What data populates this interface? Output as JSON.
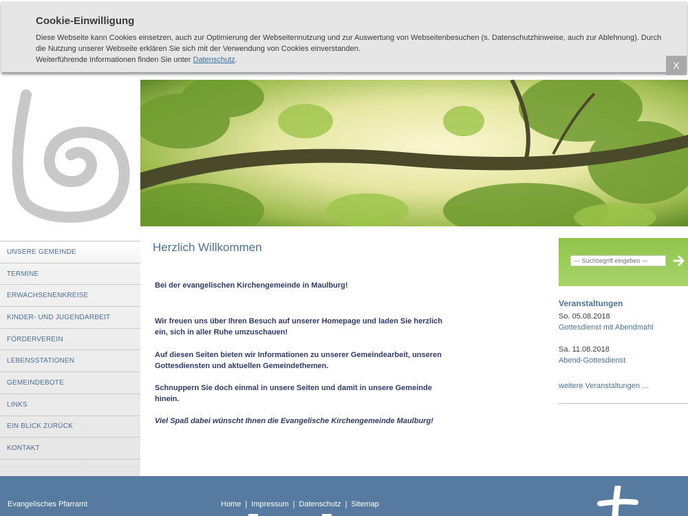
{
  "cookie": {
    "title": "Cookie-Einwilligung",
    "text1": "Diese Webseite kann Cookies einsetzen, auch zur Optimierung der Webseitennutzung und zur Auswertung von Webseitenbesuchen (s. Datenschutzhinweise, auch zur Ablehnung). Durch die Nutzung unserer Webseite erklären Sie sich mit der Verwendung von Cookies einverstanden.",
    "text2": "Weiterführende Informationen finden Sie unter ",
    "link": "Datenschutz",
    "after_link": ".",
    "close": "X"
  },
  "nav": {
    "items": [
      {
        "label": "UNSERE GEMEINDE"
      },
      {
        "label": "TERMINE"
      },
      {
        "label": "ERWACHSENENKREISE"
      },
      {
        "label": "KINDER- UND JUGENDARBEIT"
      },
      {
        "label": "FÖRDERVEREIN"
      },
      {
        "label": "LEBENSSTATIONEN"
      },
      {
        "label": "GEMEINDEBOTE"
      },
      {
        "label": "LINKS"
      },
      {
        "label": "EIN BLICK ZURÜCK"
      },
      {
        "label": "KONTAKT"
      }
    ]
  },
  "main": {
    "title": "Herzlich Willkommen",
    "paragraphs": [
      "Bei der evangelischen Kirchengemeinde in Maulburg!",
      "Wir freuen uns über Ihren Besuch auf unserer Homepage und laden Sie herzlich ein, sich in aller Ruhe umzuschauen!",
      "Auf diesen Seiten bieten wir Informationen zu unserer Gemeindearbeit, unseren Gottesdiensten und aktuellen Gemeindethemen.",
      "Schnuppern Sie doch einmal in unsere Seiten und damit in unsere Gemeinde hinein.",
      "Viel Spaß dabei wünscht Ihnen die Evangelische Kirchengemeinde Maulburg!"
    ]
  },
  "search": {
    "placeholder": "--- Suchbegriff eingeben ---"
  },
  "events": {
    "title": "Veranstaltungen",
    "items": [
      {
        "date": "So. 05.08.2018",
        "title": "Gottesdienst mit Abendmahl"
      },
      {
        "date": "Sa. 11.08.2018",
        "title": "Abend-Gottesdienst"
      }
    ],
    "more": "weitere Veranstaltungen ..."
  },
  "footer": {
    "address": "Evangelisches Pfarramt",
    "links": [
      "Home",
      "Impressum",
      "Datenschutz",
      "Sitemap"
    ],
    "separator": "|"
  },
  "colors": {
    "accent_blue": "#4d7397",
    "footer_blue": "#577ba0",
    "text_dark_blue": "#2f3b6a",
    "search_green": "#8ec44a"
  }
}
